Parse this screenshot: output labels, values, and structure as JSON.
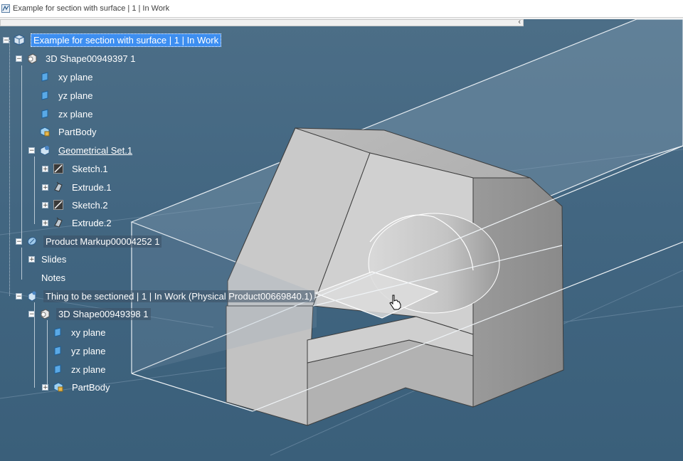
{
  "window": {
    "title": "Example for section with surface | 1 | In Work"
  },
  "scrollbar": {
    "arrow": "‹"
  },
  "tree": {
    "root": "Example for section with surface | 1 | In Work",
    "shape1": "3D Shape00949397 1",
    "xy1": "xy plane",
    "yz1": "yz plane",
    "zx1": "zx plane",
    "partbody1": "PartBody",
    "geoset": "Geometrical Set.1",
    "sketch1": "Sketch.1",
    "extrude1": "Extrude.1",
    "sketch2": "Sketch.2",
    "extrude2": "Extrude.2",
    "markup": "Product Markup00004252 1",
    "slides": "Slides",
    "notes": "Notes",
    "thing": "Thing to be sectioned | 1 | In Work (Physical Product00669840.1)",
    "shape2": "3D Shape00949398 1",
    "xy2": "xy plane",
    "yz2": "yz plane",
    "zx2": "zx plane",
    "partbody2": "PartBody"
  },
  "icons": {
    "expand": "+",
    "collapse": "−"
  },
  "colors": {
    "background": "#426681",
    "selection": "#3d8ef0",
    "part_gray": "#b4b4b4"
  }
}
